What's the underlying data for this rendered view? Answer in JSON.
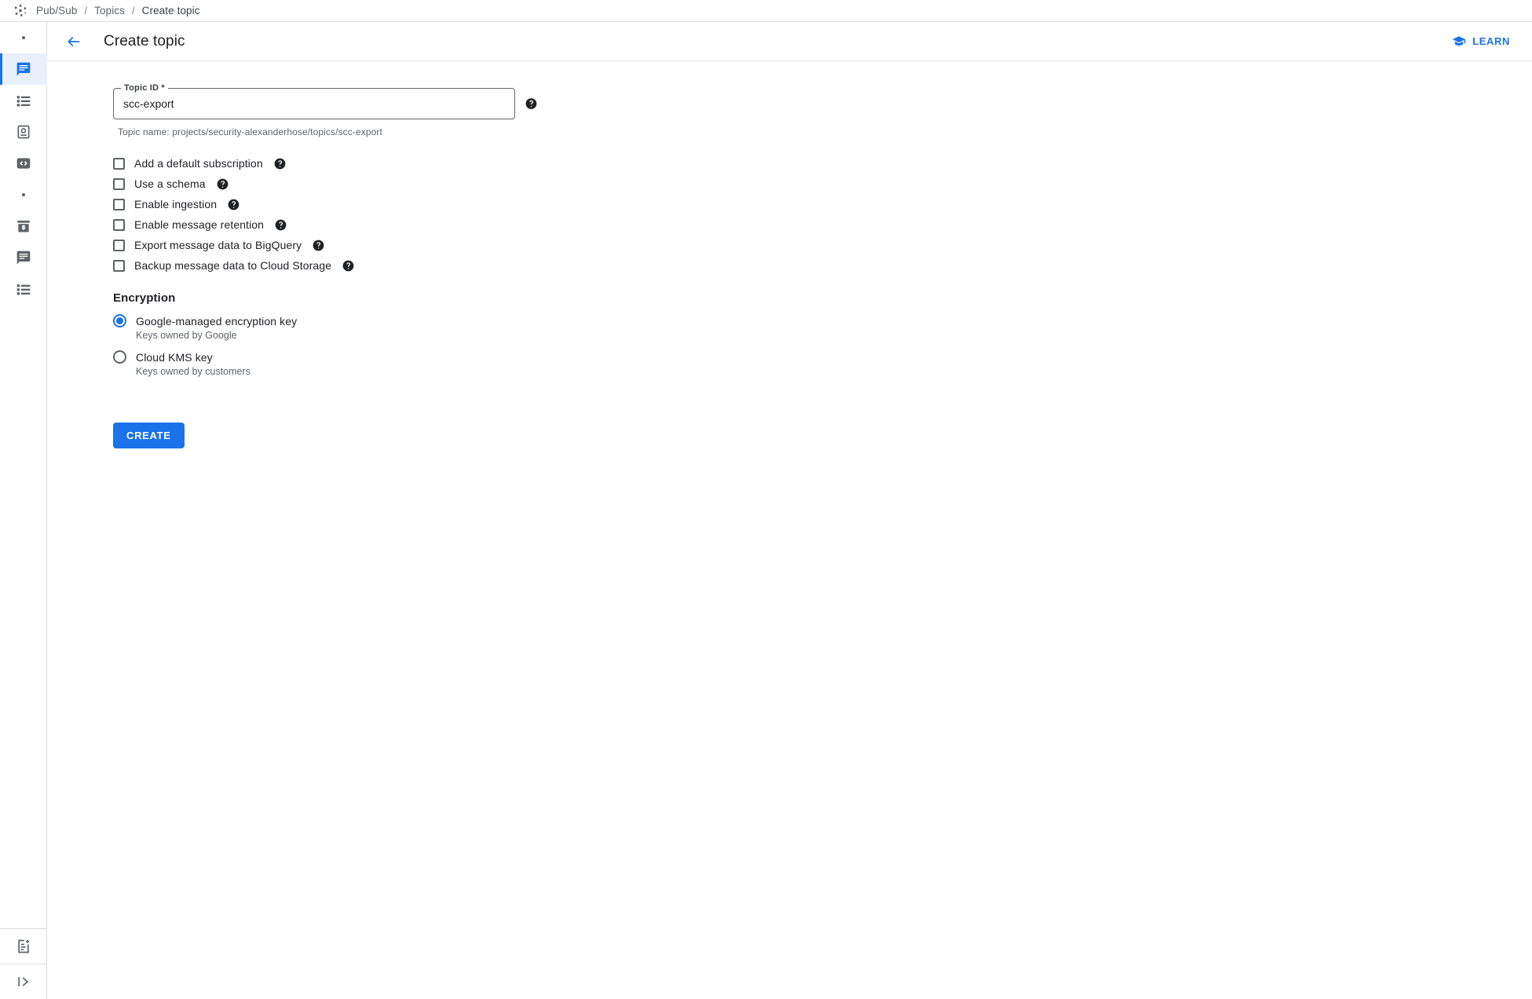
{
  "breadcrumb": {
    "logo_icon": "pubsub-cluster-icon",
    "items": [
      "Pub/Sub",
      "Topics",
      "Create topic"
    ],
    "separator": "/"
  },
  "rail": {
    "items": [
      {
        "icon": "dot-icon",
        "name": "rail-dot-top",
        "active": false
      },
      {
        "icon": "message-icon",
        "name": "rail-item-topics",
        "active": true
      },
      {
        "icon": "list-icon",
        "name": "rail-item-subscriptions",
        "active": false
      },
      {
        "icon": "snapshot-icon",
        "name": "rail-item-snapshots",
        "active": false
      },
      {
        "icon": "code-icon",
        "name": "rail-item-schemas",
        "active": false
      },
      {
        "icon": "dot-icon",
        "name": "rail-dot-middle",
        "active": false
      },
      {
        "icon": "archive-icon",
        "name": "rail-item-lite-reservations",
        "active": false
      },
      {
        "icon": "message-icon",
        "name": "rail-item-lite-topics",
        "active": false
      },
      {
        "icon": "list-icon",
        "name": "rail-item-lite-subscriptions",
        "active": false
      }
    ],
    "bottom_items": [
      {
        "icon": "note-add-icon",
        "name": "rail-item-release-notes"
      },
      {
        "icon": "expand-panel-icon",
        "name": "rail-item-expand-panel"
      }
    ]
  },
  "header": {
    "back_icon": "arrow-back-icon",
    "title": "Create topic",
    "learn_label": "LEARN",
    "learn_icon": "graduation-cap-icon",
    "accent_color": "#1a73e8"
  },
  "form": {
    "topic_id": {
      "legend": "Topic ID *",
      "value": "scc-export",
      "placeholder": "",
      "help_icon": "help-filled-icon"
    },
    "hint": "Topic name: projects/security-alexanderhose/topics/scc-export",
    "checkboxes": [
      {
        "label": "Add a default subscription",
        "checked": false,
        "name": "checkbox-add-default-subscription"
      },
      {
        "label": "Use a schema",
        "checked": false,
        "name": "checkbox-use-a-schema"
      },
      {
        "label": "Enable ingestion",
        "checked": false,
        "name": "checkbox-enable-ingestion"
      },
      {
        "label": "Enable message retention",
        "checked": false,
        "name": "checkbox-enable-message-retention"
      },
      {
        "label": "Export message data to BigQuery",
        "checked": false,
        "name": "checkbox-export-to-bigquery"
      },
      {
        "label": "Backup message data to Cloud Storage",
        "checked": false,
        "name": "checkbox-backup-to-cloud-storage"
      }
    ],
    "encryption": {
      "title": "Encryption",
      "options": [
        {
          "label": "Google-managed encryption key",
          "sub": "Keys owned by Google",
          "selected": true,
          "name": "radio-google-managed-key"
        },
        {
          "label": "Cloud KMS key",
          "sub": "Keys owned by customers",
          "selected": false,
          "name": "radio-cloud-kms-key"
        }
      ]
    },
    "submit_label": "CREATE",
    "submit_color": "#1a73e8"
  }
}
